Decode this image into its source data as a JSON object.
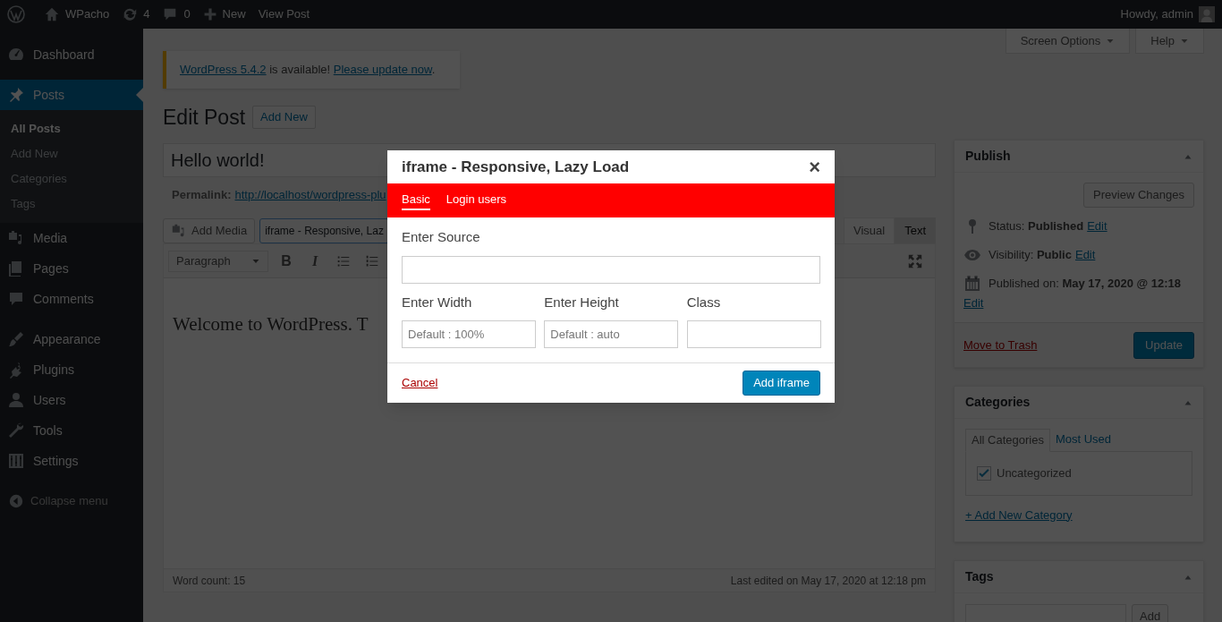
{
  "admin_bar": {
    "site": "WPacho",
    "updates": "4",
    "comments": "0",
    "new": "New",
    "view_post": "View Post",
    "greeting": "Howdy, admin"
  },
  "sidebar": {
    "groups": [
      [
        {
          "label": "Dashboard",
          "selected": false
        }
      ],
      [
        {
          "label": "Posts",
          "selected": true,
          "children": [
            {
              "label": "All Posts",
              "selected": true
            },
            {
              "label": "Add New",
              "selected": false
            },
            {
              "label": "Categories",
              "selected": false
            },
            {
              "label": "Tags",
              "selected": false
            }
          ]
        },
        {
          "label": "Media",
          "selected": false
        },
        {
          "label": "Pages",
          "selected": false
        },
        {
          "label": "Comments",
          "selected": false
        }
      ],
      [
        {
          "label": "Appearance",
          "selected": false
        },
        {
          "label": "Plugins",
          "selected": false
        },
        {
          "label": "Users",
          "selected": false
        },
        {
          "label": "Tools",
          "selected": false
        },
        {
          "label": "Settings",
          "selected": false
        }
      ]
    ],
    "collapse": "Collapse menu"
  },
  "screen_options": "Screen Options",
  "help": "Help",
  "notice": {
    "link_1": "WordPress 5.4.2",
    "text": " is available! ",
    "link_2": "Please update now",
    "end": "."
  },
  "page_title": "Edit Post",
  "add_new": "Add New",
  "post_title": "Hello world!",
  "permalink": {
    "label": "Permalink:",
    "url": "http://localhost/wordpress-plu"
  },
  "editor": {
    "add_media": "Add Media",
    "iframe_button": "iframe - Responsive, Laz",
    "tabs": [
      {
        "label": "Visual",
        "selected": true
      },
      {
        "label": "Text",
        "selected": false
      }
    ],
    "format": "Paragraph",
    "format_buttons": [
      "B",
      "I"
    ],
    "content": "Welcome to WordPress. T",
    "word_count": "Word count: 15",
    "last_edited": "Last edited on May 17, 2020 at 12:18 pm"
  },
  "publish": {
    "title": "Publish",
    "preview": "Preview Changes",
    "rows": [
      {
        "label": "Status:",
        "value": "Published",
        "edit": "Edit"
      },
      {
        "label": "Visibility:",
        "value": "Public",
        "edit": "Edit"
      },
      {
        "label": "Published on:",
        "value": "May 17, 2020 @ 12:18",
        "edit": "Edit"
      }
    ],
    "trash": "Move to Trash",
    "update": "Update"
  },
  "categories": {
    "title": "Categories",
    "tabs": [
      {
        "label": "All Categories",
        "selected": true
      },
      {
        "label": "Most Used",
        "selected": false
      }
    ],
    "items": [
      {
        "label": "Uncategorized",
        "checked": true
      }
    ],
    "add_link": "+ Add New Category"
  },
  "tags": {
    "title": "Tags",
    "add": "Add"
  },
  "modal": {
    "title": "iframe - Responsive, Lazy Load",
    "close": "×",
    "tabs": [
      {
        "label": "Basic",
        "selected": true
      },
      {
        "label": "Login users",
        "selected": false
      }
    ],
    "source": {
      "label": "Enter Source"
    },
    "fields": [
      {
        "label": "Enter Width",
        "placeholder": "Default : 100%"
      },
      {
        "label": "Enter Height",
        "placeholder": "Default : auto"
      },
      {
        "label": "Class"
      }
    ],
    "cancel": "Cancel",
    "submit": "Add iframe"
  }
}
